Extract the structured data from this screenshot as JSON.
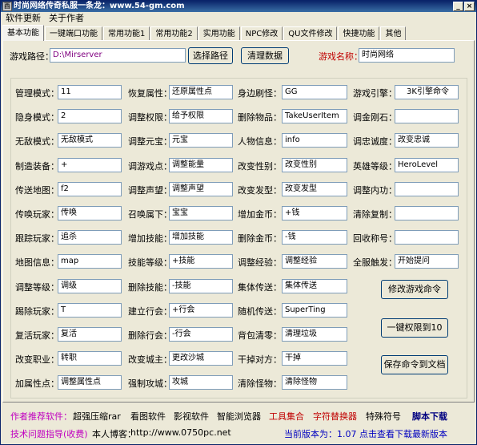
{
  "window": {
    "title": "时尚网络传奇私服一条龙：www.54-gm.com"
  },
  "menu": [
    "软件更新",
    "关于作者"
  ],
  "tabs": [
    "基本功能",
    "一键端口功能",
    "常用功能1",
    "常用功能2",
    "实用功能",
    "NPC修改",
    "QU文件修改",
    "快捷功能",
    "其他"
  ],
  "top": {
    "path_label": "游戏路径：",
    "path_value": "D:\\Mirserver",
    "choose_path": "选择路径",
    "clear_data": "清理数据",
    "game_name_label": "游戏名称：",
    "game_name_value": "时尚网络"
  },
  "fields": {
    "c1": [
      {
        "label": "管理模式：",
        "value": "11"
      },
      {
        "label": "隐身模式：",
        "value": "2"
      },
      {
        "label": "无敌模式：",
        "value": "无敌模式"
      },
      {
        "label": "制造装备：",
        "value": "+"
      },
      {
        "label": "传送地图：",
        "value": "f2"
      },
      {
        "label": "传唤玩家：",
        "value": "传唤"
      },
      {
        "label": "跟踪玩家：",
        "value": "追杀"
      },
      {
        "label": "地图信息：",
        "value": "map"
      },
      {
        "label": "调整等级：",
        "value": "调级"
      },
      {
        "label": "踢除玩家：",
        "value": "T"
      },
      {
        "label": "复活玩家：",
        "value": "复活"
      },
      {
        "label": "改变职业：",
        "value": "转职"
      },
      {
        "label": "加属性点：",
        "value": "调整属性点"
      }
    ],
    "c2": [
      {
        "label": "恢复属性：",
        "value": "还原属性点"
      },
      {
        "label": "调整权限：",
        "value": "给予权限"
      },
      {
        "label": "调整元宝：",
        "value": "元宝"
      },
      {
        "label": "调游戏点：",
        "value": "调整能量"
      },
      {
        "label": "调整声望：",
        "value": "调整声望"
      },
      {
        "label": "召唤属下：",
        "value": "宝宝"
      },
      {
        "label": "增加技能：",
        "value": "增加技能"
      },
      {
        "label": "技能等级：",
        "value": "+技能"
      },
      {
        "label": "删除技能：",
        "value": "-技能"
      },
      {
        "label": "建立行会：",
        "value": "+行会"
      },
      {
        "label": "删除行会：",
        "value": "-行会"
      },
      {
        "label": "改变城主：",
        "value": "更改沙城"
      },
      {
        "label": "强制攻城：",
        "value": "攻城"
      }
    ],
    "c3": [
      {
        "label": "身边刷怪：",
        "value": "GG"
      },
      {
        "label": "删除物品：",
        "value": "TakeUserItem"
      },
      {
        "label": "人物信息：",
        "value": "info"
      },
      {
        "label": "改变性别：",
        "value": "改变性别"
      },
      {
        "label": "改变发型：",
        "value": "改变发型"
      },
      {
        "label": "增加金币：",
        "value": "+钱"
      },
      {
        "label": "删除金币：",
        "value": "-钱"
      },
      {
        "label": "调整经验：",
        "value": "调整经验"
      },
      {
        "label": "集体传送：",
        "value": "集体传送"
      },
      {
        "label": "随机传送：",
        "value": "SuperTing"
      },
      {
        "label": "背包清零：",
        "value": "清理垃圾"
      },
      {
        "label": "干掉对方：",
        "value": "干掉"
      },
      {
        "label": "清除怪物：",
        "value": "清除怪物"
      }
    ],
    "c4": [
      {
        "label": "游戏引擎：",
        "value": "3K引擎命令"
      },
      {
        "label": "调金刚石：",
        "value": ""
      },
      {
        "label": "调忠诚度：",
        "value": "改变忠诚"
      },
      {
        "label": "英雄等级：",
        "value": "HeroLevel"
      },
      {
        "label": "调整内功：",
        "value": ""
      },
      {
        "label": "清除复制：",
        "value": ""
      },
      {
        "label": "回收称号：",
        "value": ""
      },
      {
        "label": "全服触发：",
        "value": "开始提问"
      }
    ]
  },
  "actions": {
    "modify_commands": "修改游戏命令",
    "one_key_permission": "一键权限到10",
    "save_commands": "保存命令到文档"
  },
  "bottom": {
    "recommend_label": "作者推荐软件：",
    "recommend_items": [
      "超强压缩rar",
      "看图软件",
      "影视软件",
      "智能浏览器",
      "工具集合",
      "字符替换器",
      "特殊符号",
      "脚本下载"
    ],
    "support_label": "技术问题指导(收费)",
    "blog_label": "本人博客：",
    "blog_url": "http://www.0750pc.net",
    "version_text": "当前版本为：1.07 点击查看下载最新版本"
  },
  "colors": {
    "recommend_label": "#c000c0",
    "support_label": "#c000c0",
    "tool_collection": "#c00000",
    "char_replacer": "#c00000",
    "script_download": "#000080",
    "version_text": "#0000c0",
    "game_name_label": "#c00000"
  }
}
